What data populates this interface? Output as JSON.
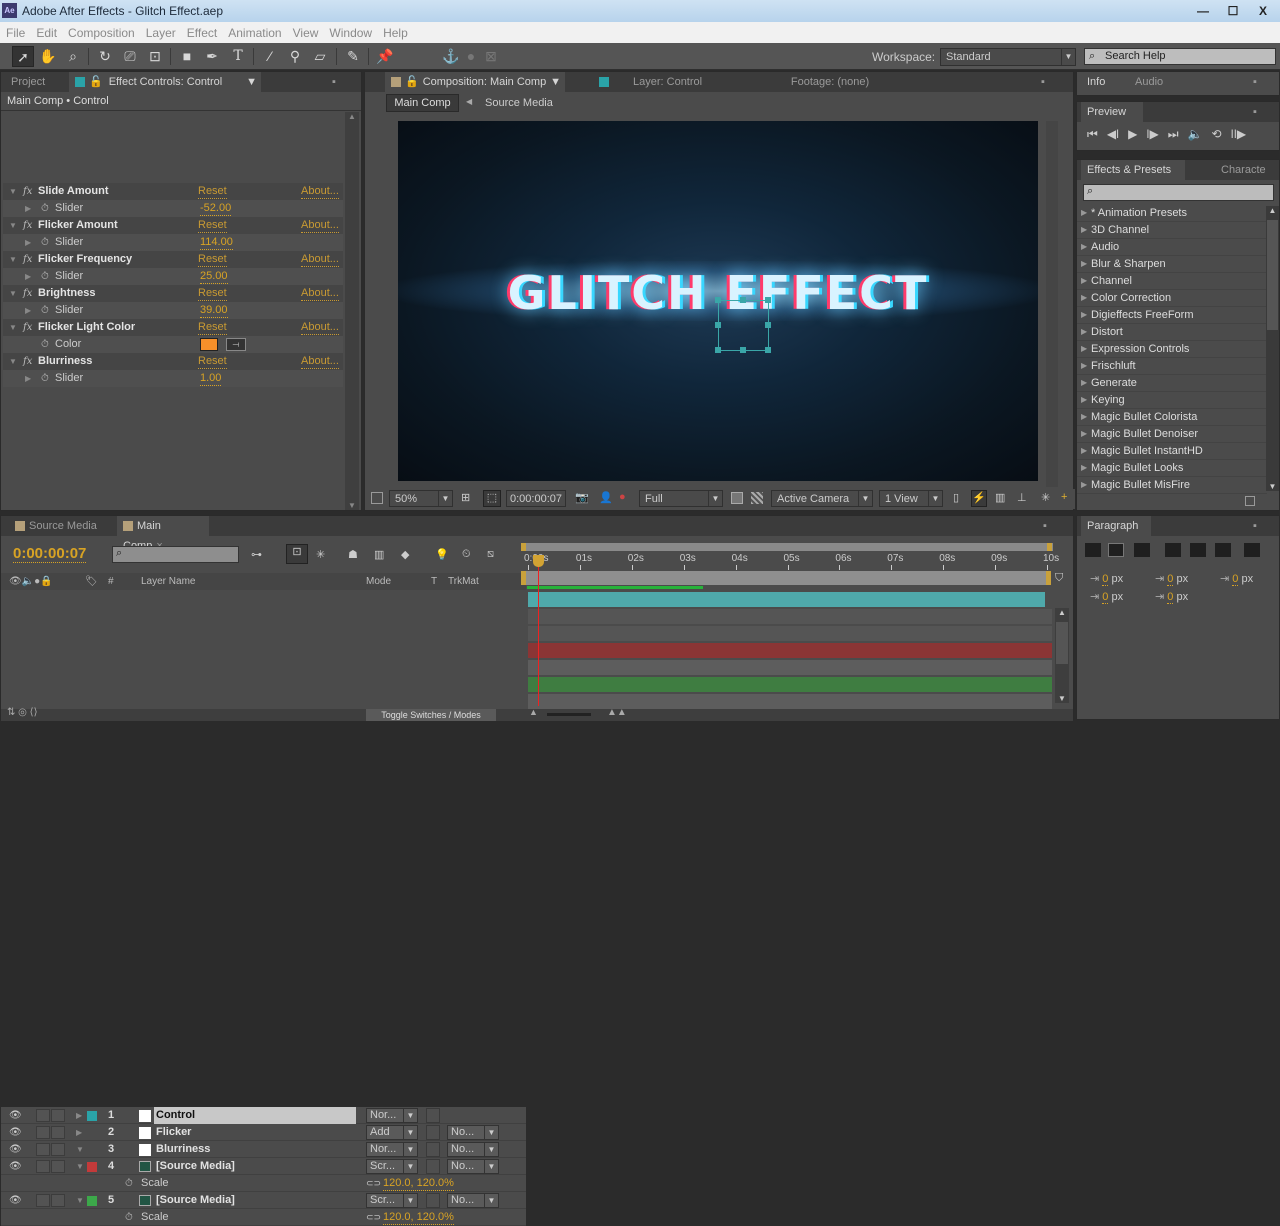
{
  "window": {
    "title": "Adobe After Effects - Glitch Effect.aep",
    "app_icon": "Ae",
    "controls": {
      "minimize": "—",
      "maximize": "☐",
      "close": "X"
    }
  },
  "menu": [
    "File",
    "Edit",
    "Composition",
    "Layer",
    "Effect",
    "Animation",
    "View",
    "Window",
    "Help"
  ],
  "toolbar": {
    "tools": [
      "selection-tool",
      "hand-tool",
      "zoom-tool",
      "rotation-tool",
      "camera-tool",
      "pan-behind-tool",
      "rectangle-tool",
      "pen-tool",
      "type-tool",
      "brush-tool",
      "clone-stamp-tool",
      "eraser-tool",
      "roto-brush-tool",
      "puppet-pin-tool"
    ],
    "workspace_label": "Workspace:",
    "workspace_value": "Standard",
    "search_placeholder": "Search Help"
  },
  "left_panel": {
    "tabs": [
      "Project",
      "Effect Controls: Control"
    ],
    "breadcrumb": "Main Comp • Control",
    "effects": [
      {
        "name": "Slide Amount",
        "param": "Slider",
        "value": "-52.00",
        "reset": "Reset",
        "about": "About..."
      },
      {
        "name": "Flicker Amount",
        "param": "Slider",
        "value": "114.00",
        "reset": "Reset",
        "about": "About..."
      },
      {
        "name": "Flicker Frequency",
        "param": "Slider",
        "value": "25.00",
        "reset": "Reset",
        "about": "About..."
      },
      {
        "name": "Brightness",
        "param": "Slider",
        "value": "39.00",
        "reset": "Reset",
        "about": "About..."
      },
      {
        "name": "Flicker Light Color",
        "param": "Color",
        "value": "#f7902a",
        "reset": "Reset",
        "about": "About..."
      },
      {
        "name": "Blurriness",
        "param": "Slider",
        "value": "1.00",
        "reset": "Reset",
        "about": "About..."
      }
    ]
  },
  "comp_panel": {
    "tabs": [
      "Composition: Main Comp",
      "Layer: Control",
      "Footage: (none)"
    ],
    "breadcrumbs": [
      "Main Comp",
      "Source Media"
    ],
    "viewer_text": "GLITCH EFFECT",
    "zoom": "50%",
    "timecode": "0:00:00:07",
    "resolution": "Full",
    "camera": "Active Camera",
    "views": "1 View"
  },
  "right_panel": {
    "info_tabs": [
      "Info",
      "Audio"
    ],
    "preview_tab": "Preview",
    "preview_controls": [
      "first-frame",
      "prev-frame",
      "play",
      "next-frame",
      "last-frame",
      "audio",
      "loop",
      "ram-preview"
    ],
    "effects_tabs": [
      "Effects & Presets",
      "Characte"
    ],
    "effects_search_placeholder": "",
    "effects_list": [
      "* Animation Presets",
      "3D Channel",
      "Audio",
      "Blur & Sharpen",
      "Channel",
      "Color Correction",
      "Digieffects FreeForm",
      "Distort",
      "Expression Controls",
      "Frischluft",
      "Generate",
      "Keying",
      "Magic Bullet Colorista",
      "Magic Bullet Denoiser",
      "Magic Bullet InstantHD",
      "Magic Bullet Looks",
      "Magic Bullet MisFire"
    ],
    "paragraph_tab": "Paragraph",
    "paragraph_fields": [
      {
        "label": "indent-left",
        "value": "0",
        "unit": "px"
      },
      {
        "label": "indent-first",
        "value": "0",
        "unit": "px"
      },
      {
        "label": "indent-right",
        "value": "0",
        "unit": "px"
      },
      {
        "label": "space-before",
        "value": "0",
        "unit": "px"
      },
      {
        "label": "space-after",
        "value": "0",
        "unit": "px"
      }
    ]
  },
  "timeline": {
    "tabs": [
      "Source Media",
      "Main Comp"
    ],
    "timecode": "0:00:00:07",
    "search_placeholder": "",
    "columns": {
      "layer_name": "Layer Name",
      "mode": "Mode",
      "t": "T",
      "trkmat": "TrkMat",
      "num": "#"
    },
    "ruler": [
      "0:00s",
      "01s",
      "02s",
      "03s",
      "04s",
      "05s",
      "06s",
      "07s",
      "08s",
      "09s",
      "10s"
    ],
    "layers": [
      {
        "num": "1",
        "name": "Control",
        "color": "#2aa3a8",
        "mode": "Nor...",
        "trkmat": "",
        "bar": "#4fa9ab",
        "selected": true
      },
      {
        "num": "2",
        "name": "Flicker",
        "color": "#4b4b4b",
        "mode": "Add",
        "trkmat": "No...",
        "bar": ""
      },
      {
        "num": "3",
        "name": "Blurriness",
        "color": "#4b4b4b",
        "mode": "Nor...",
        "trkmat": "No...",
        "bar": ""
      },
      {
        "num": "4",
        "name": "[Source Media]",
        "color": "#c33a3a",
        "mode": "Scr...",
        "trkmat": "No...",
        "bar": "#8b3535",
        "prop": "Scale",
        "prop_value": "120.0, 120.0%"
      },
      {
        "num": "5",
        "name": "[Source Media]",
        "color": "#3ca84a",
        "mode": "Scr...",
        "trkmat": "No...",
        "bar": "#3f7d41",
        "prop": "Scale",
        "prop_value": "120.0, 120.0%"
      }
    ],
    "toggle_label": "Toggle Switches / Modes",
    "work_area_progress": 0.34
  }
}
